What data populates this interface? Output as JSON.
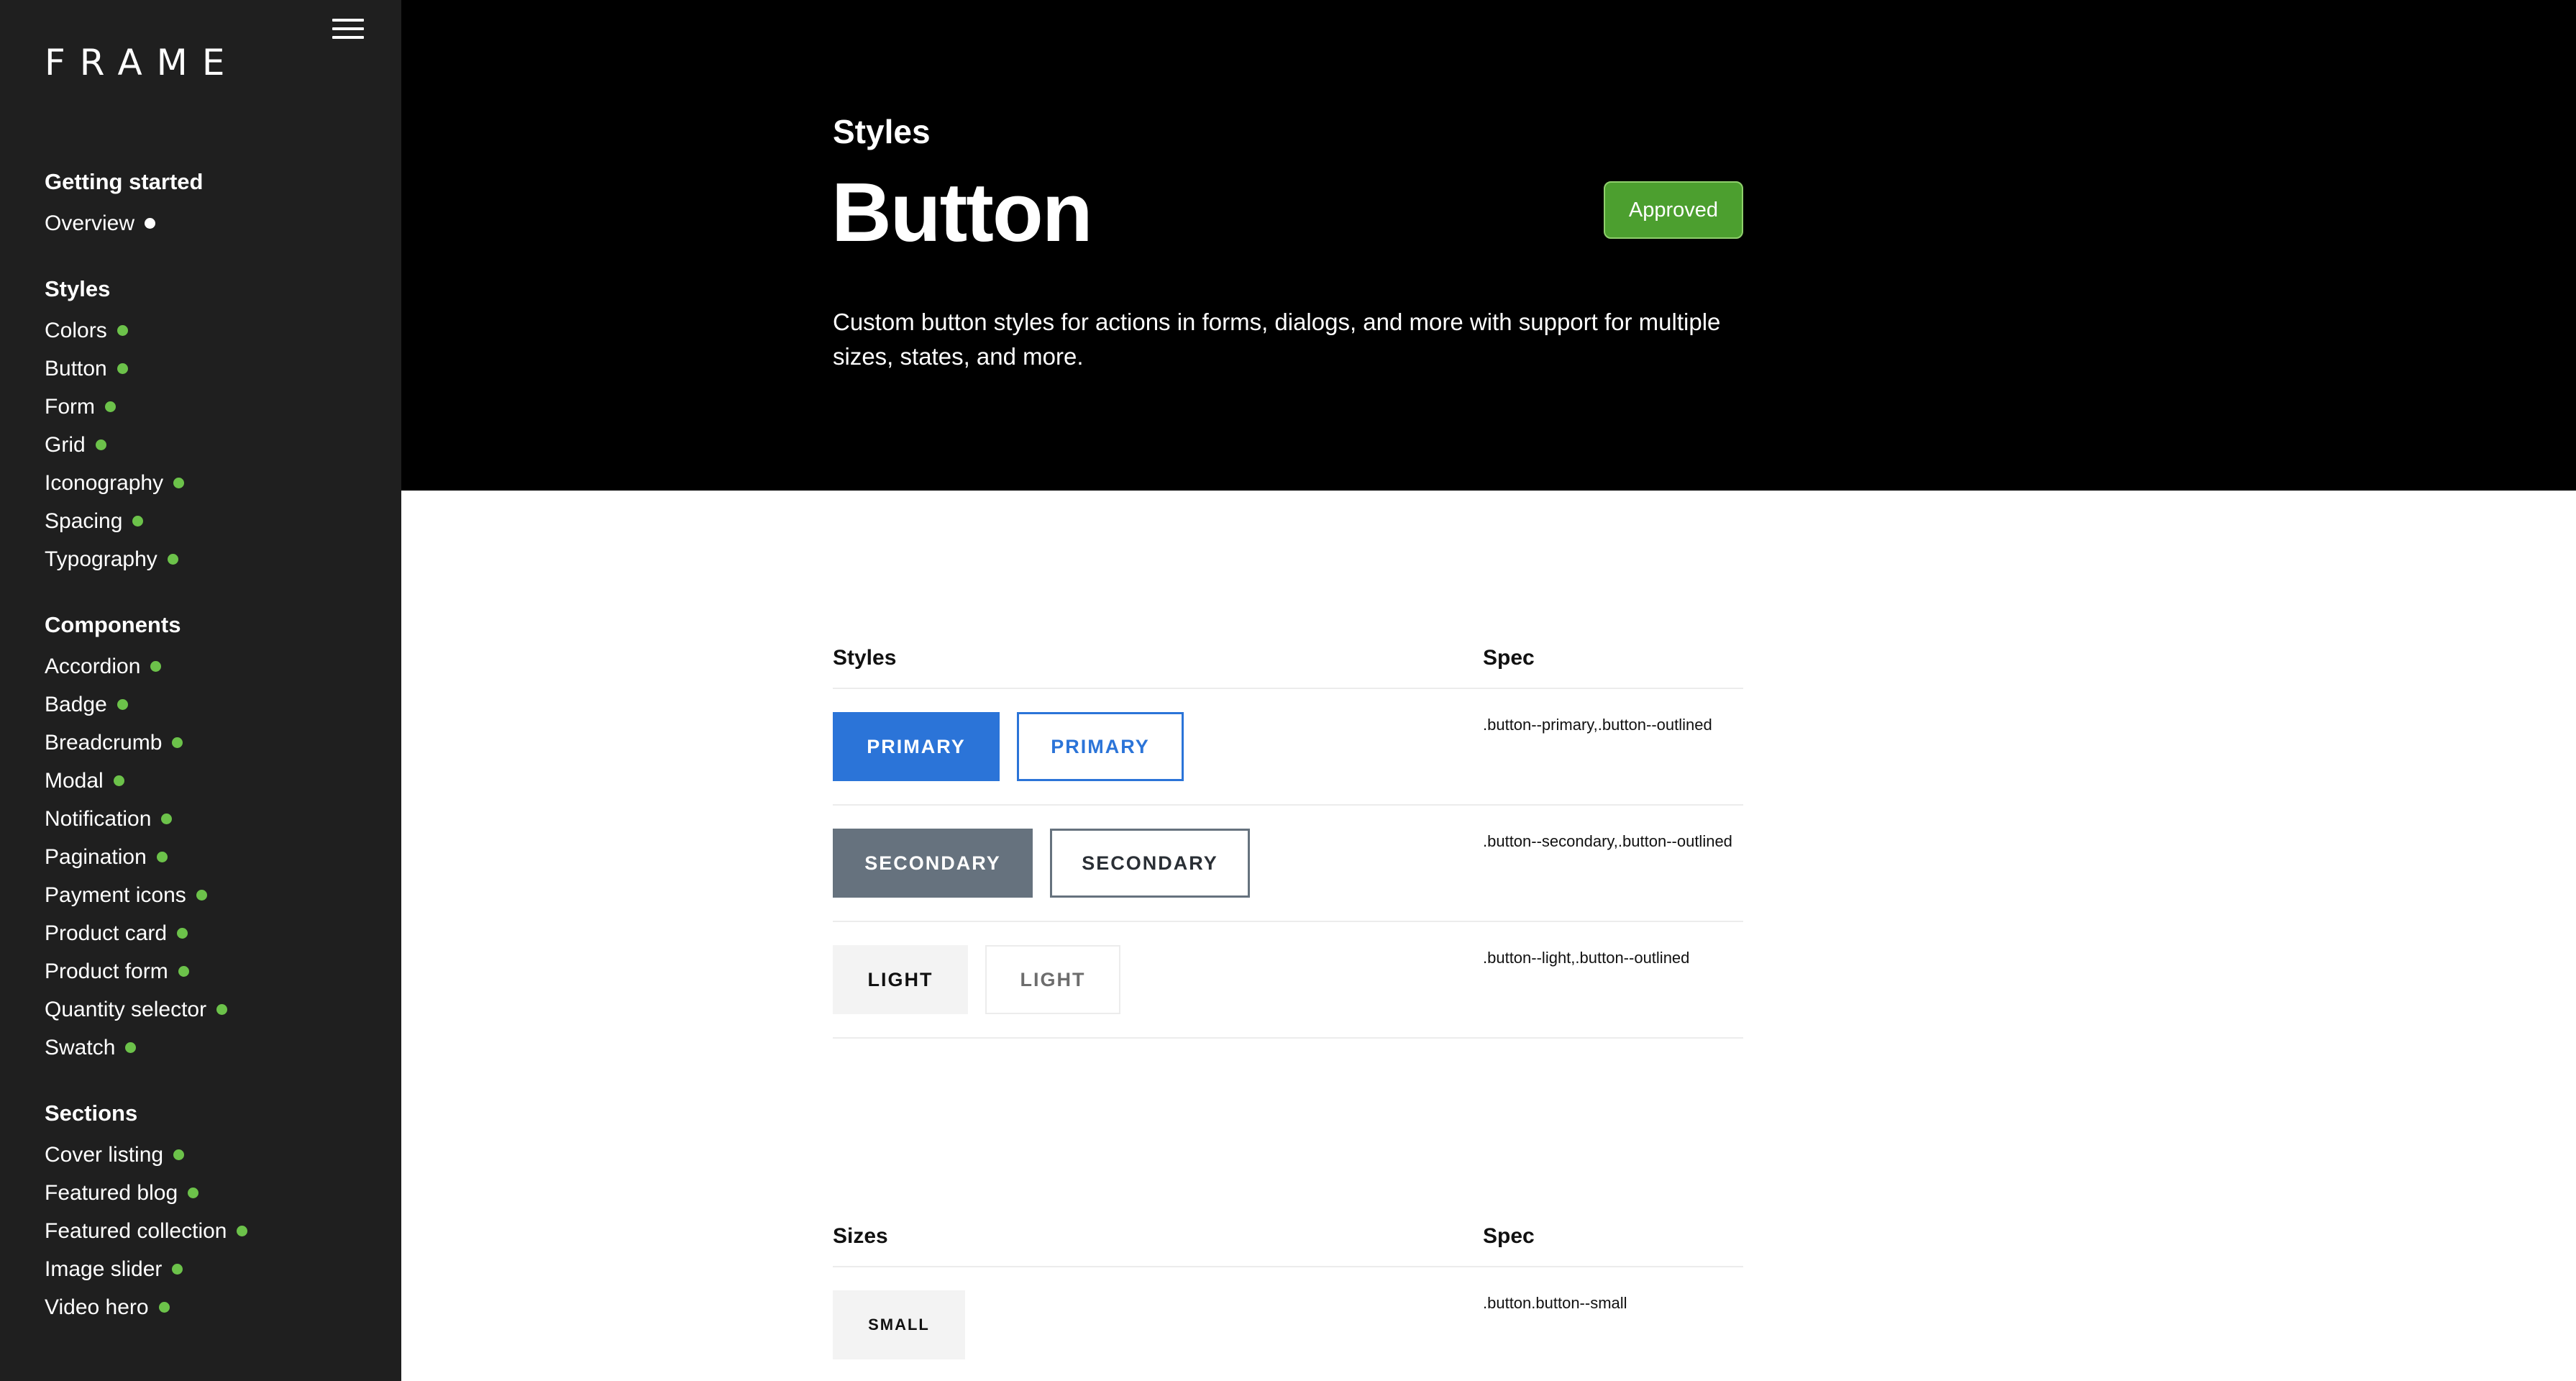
{
  "sidebar": {
    "logo": "FRAME",
    "groups": [
      {
        "heading": "Getting started",
        "items": [
          {
            "label": "Overview",
            "status": "white"
          }
        ]
      },
      {
        "heading": "Styles",
        "items": [
          {
            "label": "Colors"
          },
          {
            "label": "Button"
          },
          {
            "label": "Form"
          },
          {
            "label": "Grid"
          },
          {
            "label": "Iconography"
          },
          {
            "label": "Spacing"
          },
          {
            "label": "Typography"
          }
        ]
      },
      {
        "heading": "Components",
        "items": [
          {
            "label": "Accordion"
          },
          {
            "label": "Badge"
          },
          {
            "label": "Breadcrumb"
          },
          {
            "label": "Modal"
          },
          {
            "label": "Notification"
          },
          {
            "label": "Pagination"
          },
          {
            "label": "Payment icons"
          },
          {
            "label": "Product card"
          },
          {
            "label": "Product form"
          },
          {
            "label": "Quantity selector"
          },
          {
            "label": "Swatch"
          }
        ]
      },
      {
        "heading": "Sections",
        "items": [
          {
            "label": "Cover listing"
          },
          {
            "label": "Featured blog"
          },
          {
            "label": "Featured collection"
          },
          {
            "label": "Image slider"
          },
          {
            "label": "Video hero"
          }
        ]
      }
    ]
  },
  "hero": {
    "kicker": "Styles",
    "title": "Button",
    "badge": "Approved",
    "description": "Custom button styles for actions in forms, dialogs, and more with support for multiple sizes, states, and more."
  },
  "styles_table": {
    "col_a": "Styles",
    "col_b": "Spec",
    "rows": [
      {
        "filled": "PRIMARY",
        "outlined": "PRIMARY",
        "spec": ".button--primary,.button--outlined"
      },
      {
        "filled": "SECONDARY",
        "outlined": "SECONDARY",
        "spec": ".button--secondary,.button--outlined"
      },
      {
        "filled": "LIGHT",
        "outlined": "LIGHT",
        "spec": ".button--light,.button--outlined"
      }
    ]
  },
  "sizes_table": {
    "col_a": "Sizes",
    "col_b": "Spec",
    "rows": [
      {
        "button": "SMALL",
        "spec": ".button.button--small"
      }
    ]
  },
  "colors": {
    "sidebar_bg": "#1f1f1f",
    "status_green": "#6cc24a",
    "badge_green": "#4c9f2f",
    "primary": "#2b74d8",
    "secondary": "#66727e"
  }
}
